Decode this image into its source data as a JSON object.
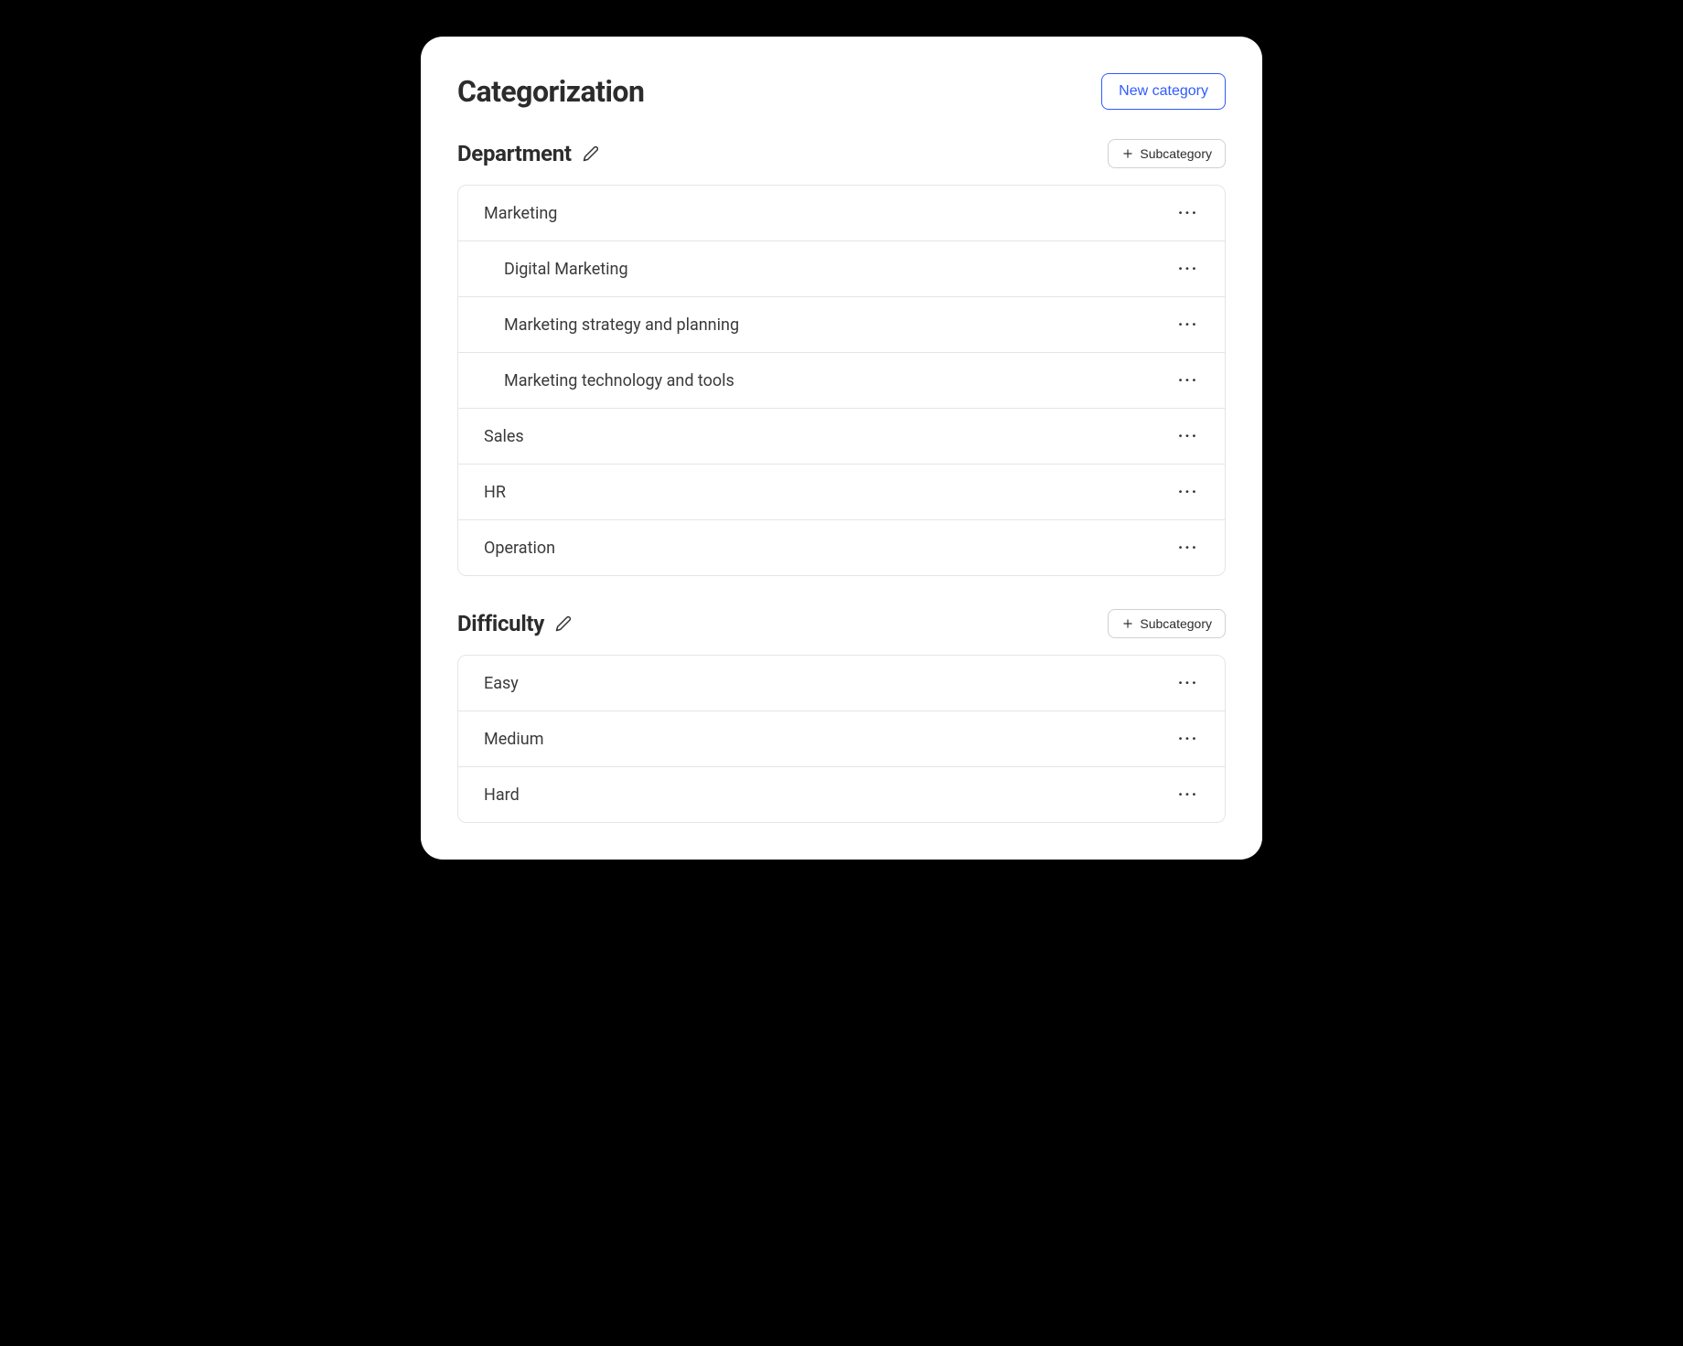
{
  "page": {
    "title": "Categorization",
    "new_category_label": "New category"
  },
  "subcategory_button_label": "Subcategory",
  "sections": [
    {
      "title": "Department",
      "items": [
        {
          "label": "Marketing",
          "indent": false
        },
        {
          "label": "Digital Marketing",
          "indent": true
        },
        {
          "label": "Marketing strategy and planning",
          "indent": true
        },
        {
          "label": "Marketing technology and tools",
          "indent": true
        },
        {
          "label": "Sales",
          "indent": false
        },
        {
          "label": "HR",
          "indent": false
        },
        {
          "label": "Operation",
          "indent": false
        }
      ]
    },
    {
      "title": "Difficulty",
      "items": [
        {
          "label": "Easy",
          "indent": false
        },
        {
          "label": "Medium",
          "indent": false
        },
        {
          "label": "Hard",
          "indent": false
        }
      ]
    }
  ]
}
